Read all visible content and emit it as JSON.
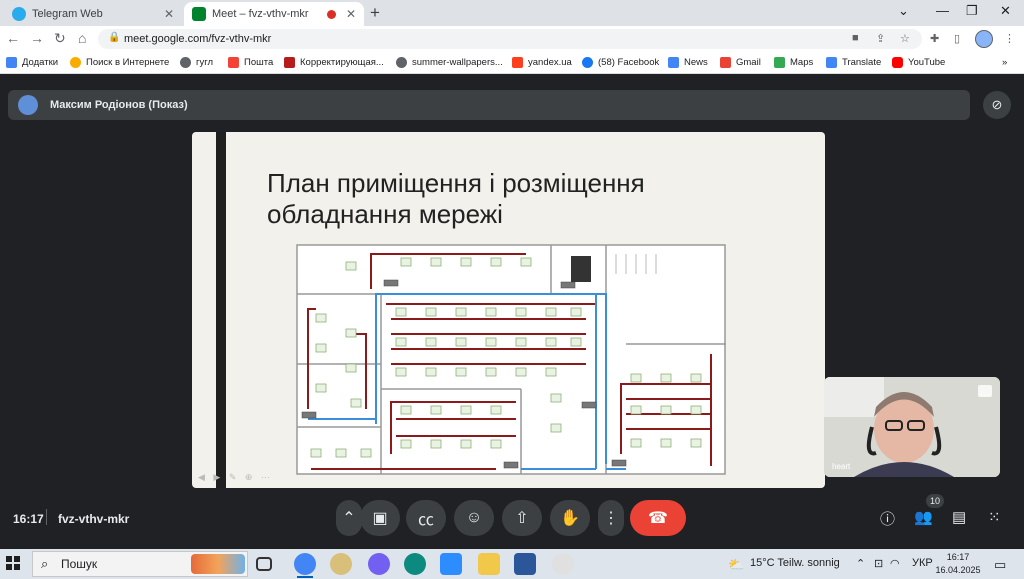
{
  "browser": {
    "tabs": [
      {
        "title": "Telegram Web",
        "active": false
      },
      {
        "title": "Meet – fvz-vthv-mkr",
        "active": true,
        "recording": true
      }
    ],
    "url": "meet.google.com/fvz-vthv-mkr",
    "bookmarks": [
      {
        "label": "Додатки",
        "icon": "apps-grid-icon"
      },
      {
        "label": "Поиск в Интернете",
        "icon": "search-bookmark-icon"
      },
      {
        "label": "гугл",
        "icon": "globe-icon"
      },
      {
        "label": "Пошта",
        "icon": "mail-icon"
      },
      {
        "label": "Корректирующая...",
        "icon": "bookmark-icon"
      },
      {
        "label": "summer-wallpapers...",
        "icon": "globe-icon"
      },
      {
        "label": "yandex.ua",
        "icon": "yandex-icon"
      },
      {
        "label": "(58) Facebook",
        "icon": "facebook-icon"
      },
      {
        "label": "News",
        "icon": "news-icon"
      },
      {
        "label": "Gmail",
        "icon": "gmail-icon"
      },
      {
        "label": "Maps",
        "icon": "maps-icon"
      },
      {
        "label": "Translate",
        "icon": "translate-icon"
      },
      {
        "label": "YouTube",
        "icon": "youtube-icon"
      }
    ]
  },
  "meet": {
    "presenter_label": "Максим Родіонов (Показ)",
    "slide_title": "План приміщення і розміщення обладнання мережі",
    "self_view_label": "heart",
    "clock": "16:17",
    "meeting_code": "fvz-vthv-mkr",
    "participants_count": "10",
    "colors": {
      "end_call": "#ea4335",
      "bar": "#3c4043",
      "background": "#202124"
    }
  },
  "taskbar": {
    "search_placeholder": "Пошук",
    "weather": "15°C  Teilw. sonnig",
    "language": "УКР",
    "time": "16:17",
    "date": "16.04.2025"
  }
}
